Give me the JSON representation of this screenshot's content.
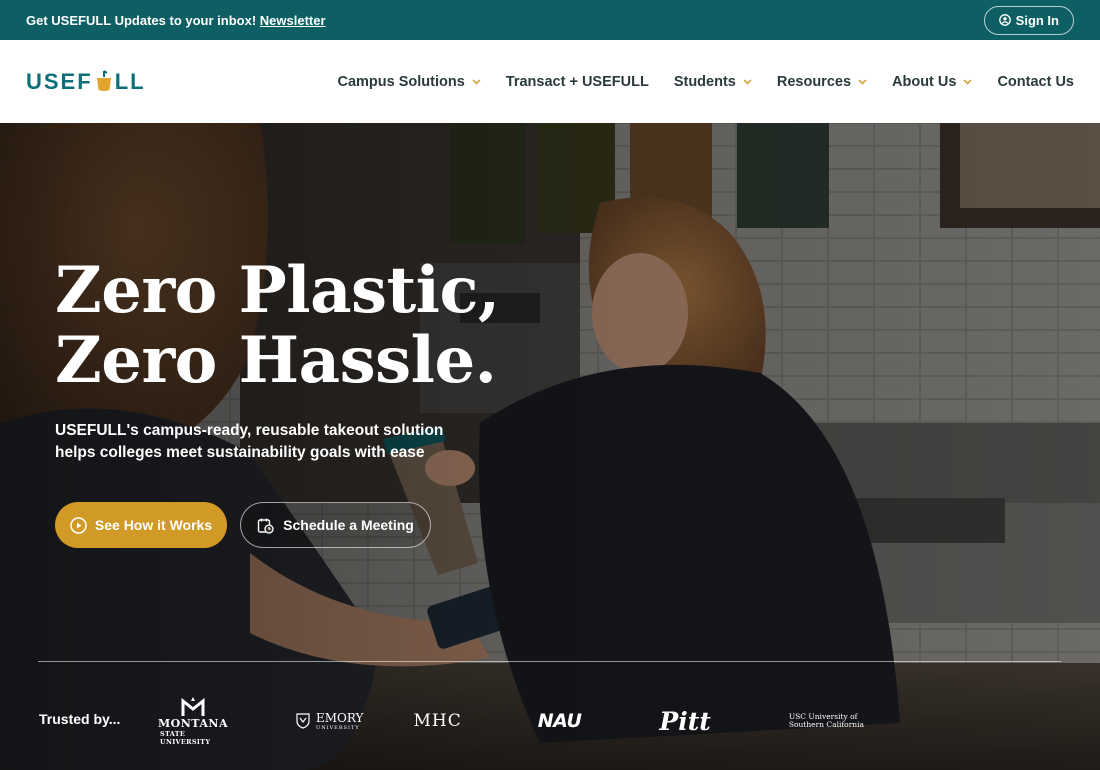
{
  "topbar": {
    "message": "Get USEFULL Updates to your inbox!",
    "newsletter_link": "Newsletter",
    "signin_label": "Sign In"
  },
  "nav": {
    "logo_text_left": "USEF",
    "logo_text_right": "LL",
    "items": [
      {
        "label": "Campus Solutions",
        "has_dropdown": true
      },
      {
        "label": "Transact + USEFULL",
        "has_dropdown": false
      },
      {
        "label": "Students",
        "has_dropdown": true
      },
      {
        "label": "Resources",
        "has_dropdown": true
      },
      {
        "label": "About Us",
        "has_dropdown": true
      },
      {
        "label": "Contact Us",
        "has_dropdown": false
      }
    ]
  },
  "hero": {
    "title_line1": "Zero Plastic,",
    "title_line2": "Zero Hassle.",
    "subtitle": "USEFULL's campus-ready, reusable takeout solution helps colleges meet sustainability goals with ease",
    "primary_button": "See How it Works",
    "secondary_button": "Schedule a Meeting",
    "trusted_label": "Trusted by...",
    "universities": {
      "montana_line1": "MONTANA",
      "montana_line2": "STATE UNIVERSITY",
      "emory_line1": "EMORY",
      "emory_line2": "UNIVERSITY",
      "mhc": "MHC",
      "nau": "NAU",
      "pitt": "Pitt",
      "usc_line1": "USC University of",
      "usc_line2": "Southern California"
    }
  },
  "colors": {
    "topbar_bg": "#0d5f63",
    "brand_teal": "#0d6f77",
    "accent_gold": "#d19a27",
    "nav_text": "#2b3a3e"
  }
}
